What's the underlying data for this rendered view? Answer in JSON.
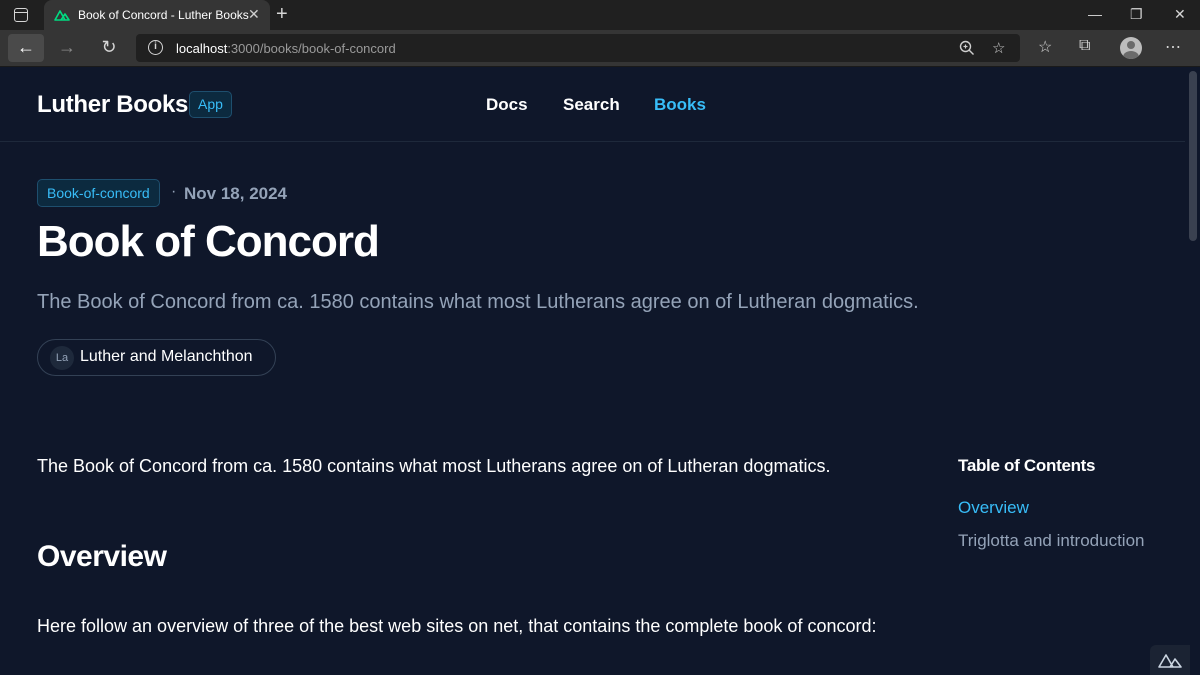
{
  "browser": {
    "tab_title": "Book of Concord - Luther Books",
    "tab_close": "✕",
    "new_tab": "+",
    "url_host": "localhost",
    "url_rest": ":3000/books/book-of-concord",
    "icons": [
      "tab-actions-icon",
      "nuxt-favicon-icon",
      "back-icon",
      "forward-icon",
      "reload-icon",
      "site-info-icon",
      "zoom-icon",
      "add-favorite-icon",
      "favorites-icon",
      "collections-icon",
      "profile-icon",
      "more-icon",
      "minimize-icon",
      "restore-icon",
      "close-icon"
    ]
  },
  "header": {
    "brand": "Luther Books",
    "badge": "App",
    "nav": [
      {
        "label": "Docs",
        "active": false
      },
      {
        "label": "Search",
        "active": false
      },
      {
        "label": "Books",
        "active": true
      }
    ],
    "accent_color": "#38bdf8"
  },
  "post": {
    "tag": "Book-of-concord",
    "separator": "·",
    "date": "Nov 18, 2024",
    "title": "Book of Concord",
    "description": "The Book of Concord from ca. 1580 contains what most Lutherans agree on of Lutheran dogmatics.",
    "author_initials": "La",
    "author": "Luther and Melanchthon"
  },
  "content": {
    "intro": "The Book of Concord from ca. 1580 contains what most Lutherans agree on of Lutheran dogmatics.",
    "heading": "Overview",
    "paragraph": "Here follow an overview of three of the best web sites on net, that contains the complete book of concord:"
  },
  "toc": {
    "title": "Table of Contents",
    "items": [
      "Overview",
      "Triglotta and introduction"
    ]
  }
}
